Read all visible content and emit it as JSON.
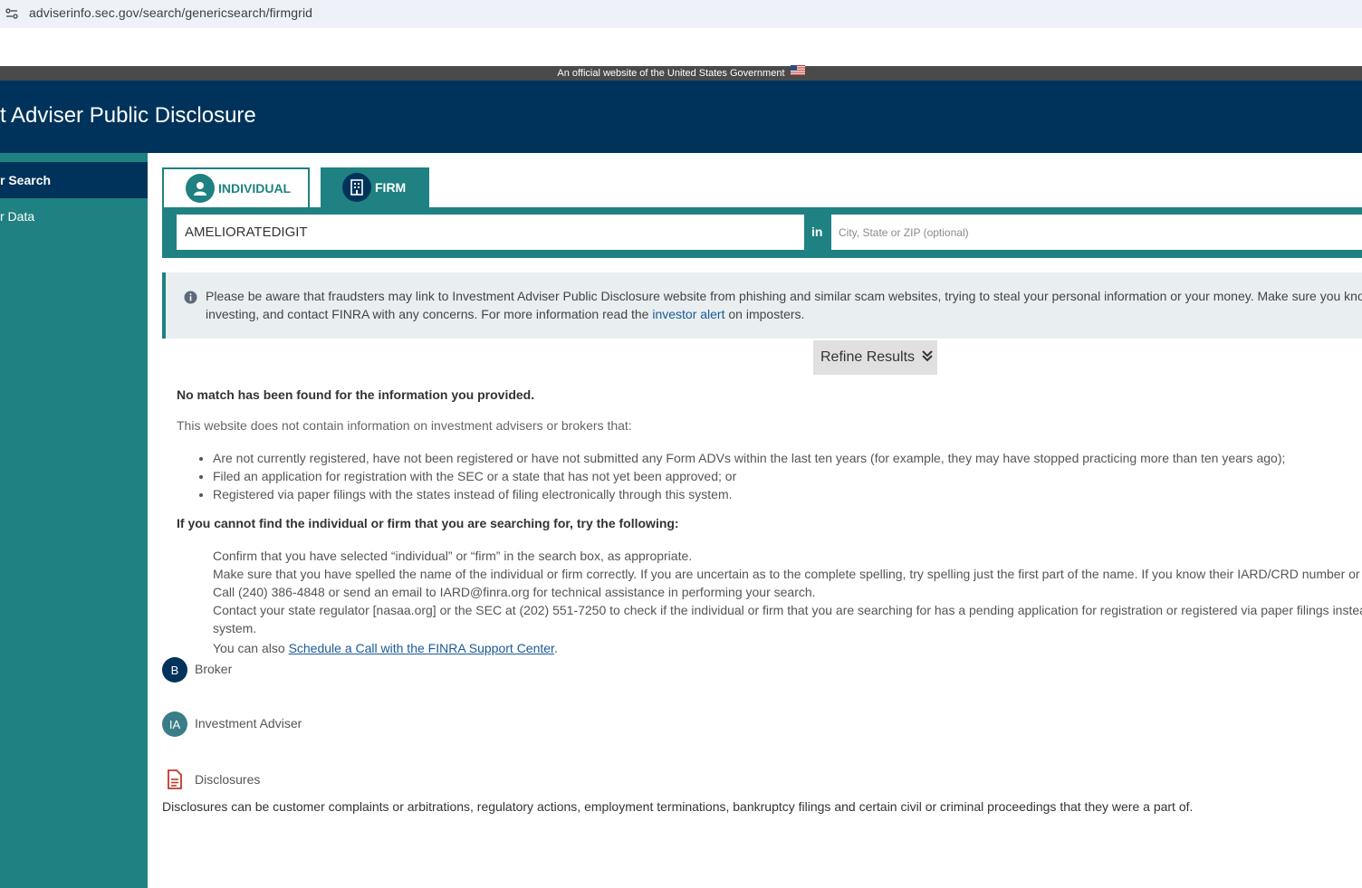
{
  "browser": {
    "url": "adviserinfo.sec.gov/search/genericsearch/firmgrid"
  },
  "gov_banner": {
    "text": "An official website of the United States Government"
  },
  "header": {
    "title": "t Adviser Public Disclosure"
  },
  "sidebar": {
    "items": [
      {
        "label": "r Search"
      },
      {
        "label": "r Data"
      }
    ]
  },
  "tabs": [
    {
      "label": "INDIVIDUAL",
      "icon": "person-icon"
    },
    {
      "label": "FIRM",
      "icon": "building-icon"
    }
  ],
  "search": {
    "name_value": "AMELIORATEDIGIT",
    "in_label": "in",
    "location_placeholder": "City, State or ZIP (optional)"
  },
  "alert": {
    "line1": "Please be aware that fraudsters may link to Investment Adviser Public Disclosure website from phishing and similar scam websites, trying to steal your personal information or your money. Make sure you know w",
    "line2_before": "investing, and contact FINRA with any concerns. For more information read the ",
    "line2_link": "investor alert",
    "line2_after": " on imposters."
  },
  "refine": {
    "label": "Refine Results"
  },
  "results": {
    "no_match": "No match has been found for the information you provided.",
    "intro": "This website does not contain information on investment advisers or brokers that:",
    "bullets": [
      "Are not currently registered, have not been registered or have not submitted any Form ADVs within the last ten years (for example, they may have stopped practicing more than ten years ago);",
      "Filed an application for registration with the SEC or a state that has not yet been approved; or",
      "Registered via paper filings with the states instead of filing electronically through this system."
    ],
    "try_heading": "If you cannot find the individual or firm that you are searching for, try the following:",
    "steps": [
      "Confirm that you have selected “individual” or “firm” in the search box, as appropriate.",
      "Make sure that you have spelled the name of the individual or firm correctly. If you are uncertain as to the complete spelling, try spelling just the first part of the name. If you know their IARD/CRD number or SEC",
      "Call (240) 386-4848 or send an email to IARD@finra.org for technical assistance in performing your search.",
      "Contact your state regulator [nasaa.org] or the SEC at (202) 551-7250 to check if the individual or firm that you are searching for has a pending application for registration or registered via paper filings instead o",
      "system."
    ],
    "step5_before": "You can also ",
    "step5_link": "Schedule a Call with the FINRA Support Center",
    "step5_after": "."
  },
  "legend": {
    "broker_badge": "B",
    "broker_label": "Broker",
    "ia_badge": "IA",
    "ia_label": "Investment Adviser",
    "disclosures_label": "Disclosures",
    "disclosures_text": "Disclosures can be customer complaints or arbitrations, regulatory actions, employment terminations, bankruptcy filings and certain civil or criminal proceedings that they were a part of."
  },
  "colors": {
    "navy": "#00335b",
    "teal": "#1f8181",
    "link": "#1a5a96"
  }
}
